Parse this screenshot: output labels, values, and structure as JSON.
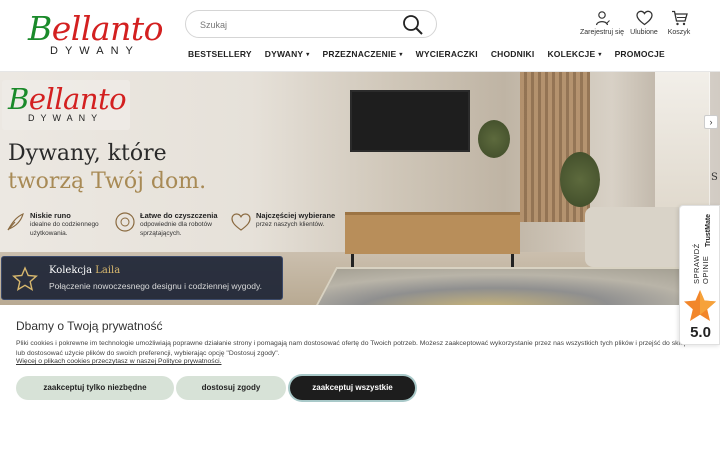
{
  "header": {
    "logo_main_b": "B",
    "logo_main_rest": "ellanto",
    "logo_sub": "DYWANY",
    "search_placeholder": "Szukaj",
    "icons": {
      "register_label": "Zarejestruj się",
      "favorites_label": "Ulubione",
      "cart_label": "Koszyk"
    },
    "nav": [
      {
        "label": "BESTSELLERY",
        "dropdown": false
      },
      {
        "label": "DYWANY",
        "dropdown": true
      },
      {
        "label": "PRZEZNACZENIE",
        "dropdown": true
      },
      {
        "label": "WYCIERACZKI",
        "dropdown": false
      },
      {
        "label": "CHODNIKI",
        "dropdown": false
      },
      {
        "label": "KOLEKCJE",
        "dropdown": true
      },
      {
        "label": "PROMOCJE",
        "dropdown": false
      }
    ],
    "chevron_glyph": "▾"
  },
  "hero": {
    "logo_main_b": "B",
    "logo_main_rest": "ellanto",
    "logo_sub": "DYWANY",
    "headline_line1": "Dywany, które",
    "headline_line2": "tworzą Twój dom.",
    "features": [
      {
        "title": "Niskie runo",
        "desc1": "idealne do codziennego",
        "desc2": "użytkowania."
      },
      {
        "title": "Łatwe do czyszczenia",
        "desc1": "odpowiednie dla robotów",
        "desc2": "sprzątających."
      },
      {
        "title": "Najczęściej wybierane",
        "desc1": "przez naszych klientów.",
        "desc2": ""
      }
    ],
    "collection_prefix": "Kolekcja ",
    "collection_name": "Laila",
    "collection_desc": "Połączenie nowoczesnego designu i codziennej wygody.",
    "next_partial_text": "S",
    "next_arrow": "›"
  },
  "trustmate": {
    "line1": "SPRAWDŹ OPINIE",
    "line2": "TrustMate",
    "score": "5.0"
  },
  "cookie": {
    "title": "Dbamy o Twoją prywatność",
    "text": "Pliki cookies i pokrewne im technologie umożliwiają poprawne działanie strony i pomagają nam dostosować ofertę do Twoich potrzeb. Możesz zaakceptować wykorzystanie przez nas wszystkich tych plików i przejść do sklepu lub dostosować użycie plików do swoich preferencji, wybierając opcję \"Dostosuj zgody\".",
    "link": "Więcej o plikach cookies przeczytasz w naszej Polityce prywatności.",
    "btn_necessary": "zaakceptuj tylko niezbędne",
    "btn_customize": "dostosuj zgody",
    "btn_accept_all": "zaakceptuj wszystkie"
  },
  "colors": {
    "logo_green": "#1a8a2a",
    "logo_red": "#d32020",
    "accent_gold": "#a88a55",
    "cookie_btn_bg": "#d7e2d7",
    "primary_btn_bg": "#1d1d1d"
  }
}
